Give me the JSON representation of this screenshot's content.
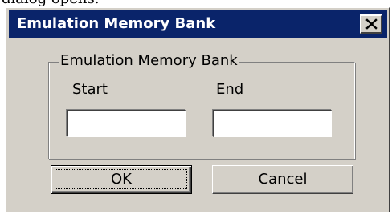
{
  "page_caption_fragment": "dialog opens.",
  "window": {
    "title": "Emulation Memory Bank",
    "close_symbol": "close-x-icon"
  },
  "group": {
    "legend": "Emulation Memory Bank",
    "start_label": "Start",
    "end_label": "End",
    "start_value": "",
    "end_value": ""
  },
  "buttons": {
    "ok_label": "OK",
    "cancel_label": "Cancel"
  },
  "colors": {
    "titlebar": "#0a246a",
    "face": "#d4d0c8"
  }
}
